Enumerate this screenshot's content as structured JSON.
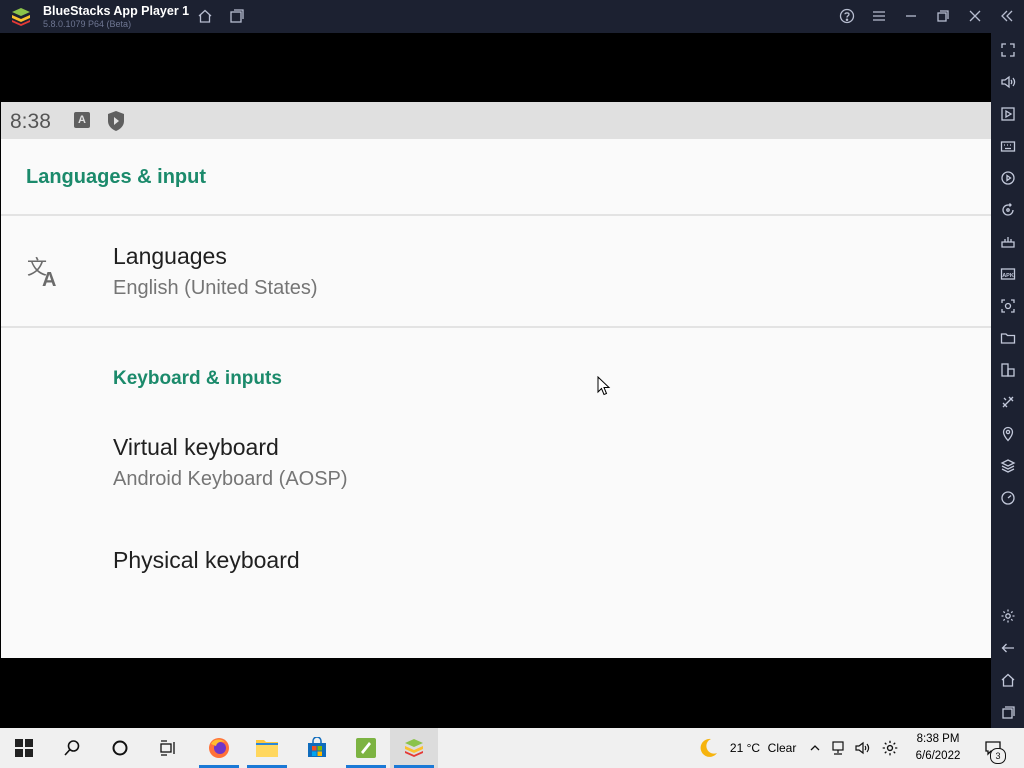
{
  "window": {
    "title": "BlueStacks App Player 1",
    "version": "5.8.0.1079 P64 (Beta)"
  },
  "status_bar": {
    "time": "8:38",
    "badge_letter": "A"
  },
  "settings": {
    "header": "Languages & input",
    "languages": {
      "title": "Languages",
      "subtitle": "English (United States)"
    },
    "section": "Keyboard & inputs",
    "virtual_keyboard": {
      "title": "Virtual keyboard",
      "subtitle": "Android Keyboard (AOSP)"
    },
    "physical_keyboard": {
      "title": "Physical keyboard"
    }
  },
  "taskbar": {
    "weather_temp": "21 °C",
    "weather_condition": "Clear",
    "time": "8:38 PM",
    "date": "6/6/2022",
    "notification_count": "3"
  },
  "colors": {
    "accent": "#1b8a6b",
    "chrome": "#1c2131",
    "taskbar_active": "#1b79d6"
  }
}
